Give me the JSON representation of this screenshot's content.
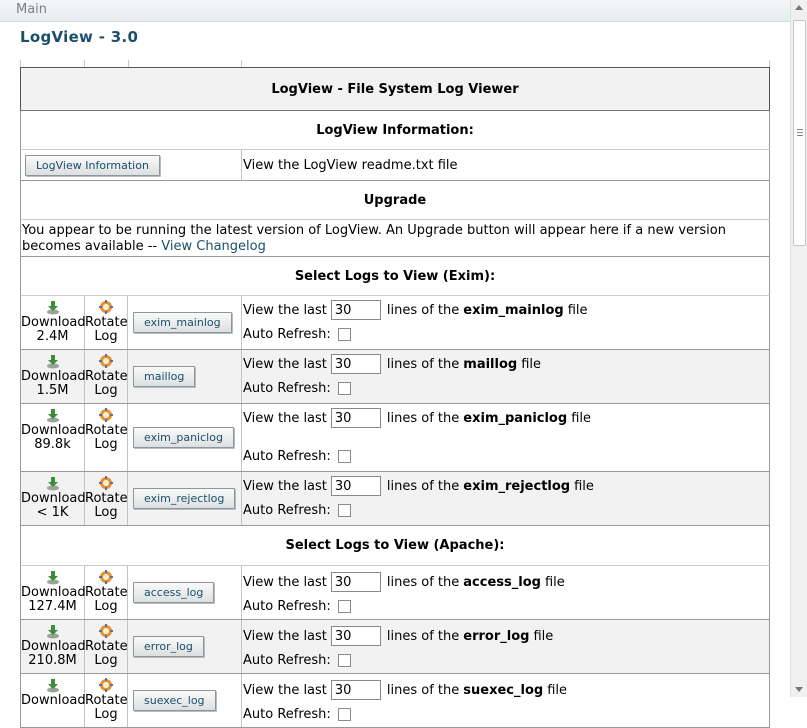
{
  "breadcrumb": "Main",
  "app_title": "LogView - 3.0",
  "panel_title": "LogView - File System Log Viewer",
  "info": {
    "section_title": "LogView Information:",
    "button_label": "LogView Information",
    "description": "View the LogView readme.txt file"
  },
  "upgrade": {
    "section_title": "Upgrade",
    "message": "You appear to be running the latest version of LogView. An Upgrade button will appear here if a new version becomes available --",
    "changelog_link": "View Changelog"
  },
  "labels": {
    "download": "Download",
    "rotate": "Rotate",
    "log": "Log",
    "view_last": "View the last",
    "lines_of_the": "lines of the",
    "file": "file",
    "auto_refresh": "Auto Refresh:"
  },
  "exim": {
    "section_title": "Select Logs to View (Exim):",
    "logs": [
      {
        "name": "exim_mainlog",
        "size": "2.4M",
        "lines": "30"
      },
      {
        "name": "maillog",
        "size": "1.5M",
        "lines": "30"
      },
      {
        "name": "exim_paniclog",
        "size": "89.8k",
        "lines": "30"
      },
      {
        "name": "exim_rejectlog",
        "size": "< 1K",
        "lines": "30"
      }
    ]
  },
  "apache": {
    "section_title": "Select Logs to View (Apache):",
    "logs": [
      {
        "name": "access_log",
        "size": "127.4M",
        "lines": "30"
      },
      {
        "name": "error_log",
        "size": "210.8M",
        "lines": "30"
      },
      {
        "name": "suexec_log",
        "size": "",
        "lines": "30"
      }
    ]
  },
  "icons": {
    "download": "download-icon",
    "rotate": "rotate-log-icon"
  }
}
